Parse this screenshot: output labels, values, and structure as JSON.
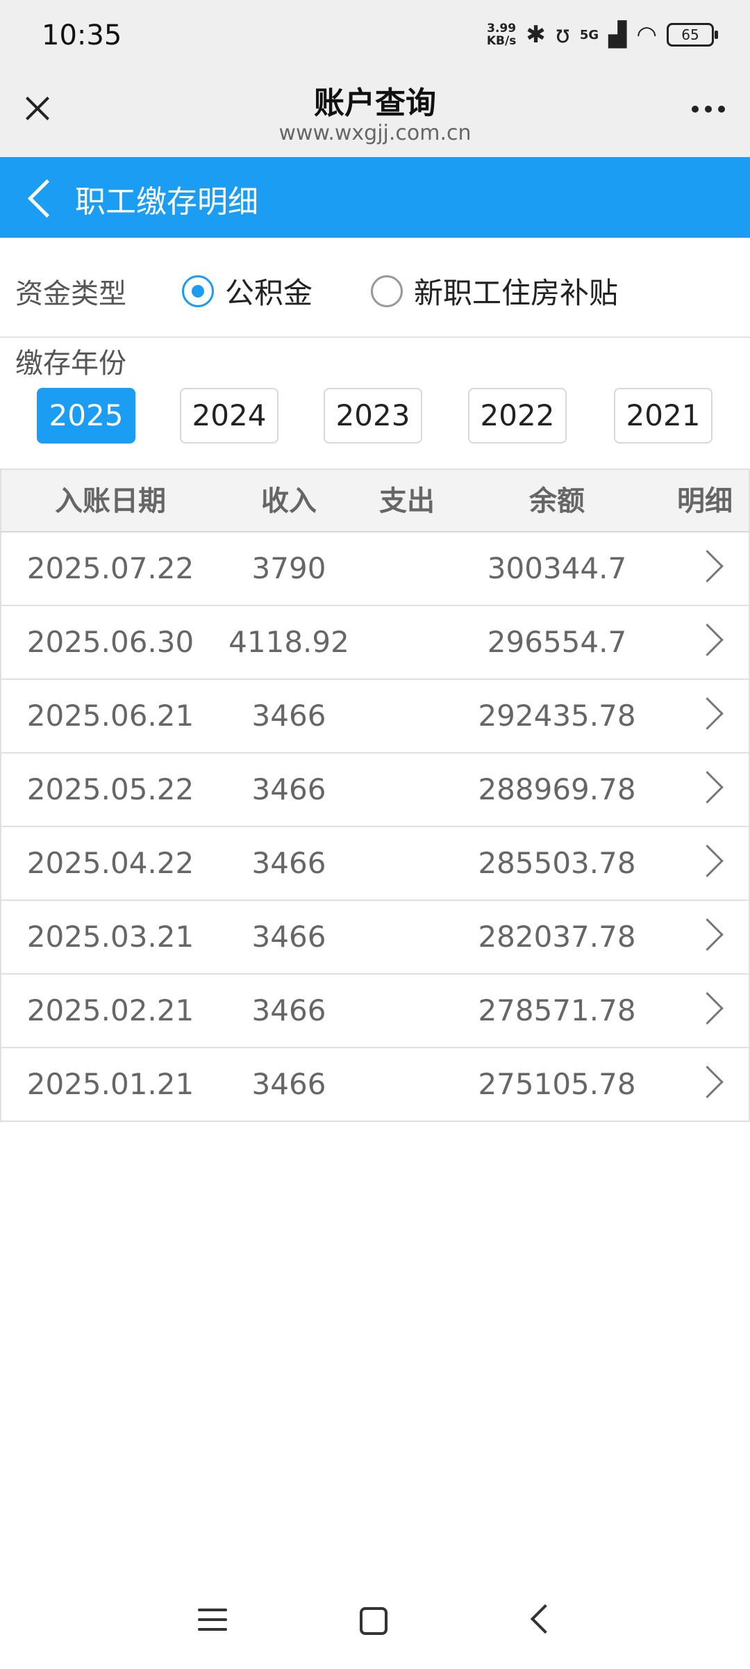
{
  "status_bar": {
    "time": "10:35",
    "net_speed_value": "3.99",
    "net_speed_unit": "KB/s",
    "network": "5G",
    "battery": "65"
  },
  "browser": {
    "title": "账户查询",
    "url": "www.wxgjj.com.cn"
  },
  "page": {
    "title": "职工缴存明细"
  },
  "fund_type": {
    "label": "资金类型",
    "options": [
      {
        "label": "公积金",
        "checked": true
      },
      {
        "label": "新职工住房补贴",
        "checked": false
      }
    ]
  },
  "year": {
    "label": "缴存年份",
    "options": [
      "2025",
      "2024",
      "2023",
      "2022",
      "2021"
    ],
    "selected": "2025"
  },
  "table": {
    "headers": {
      "date": "入账日期",
      "income": "收入",
      "expense": "支出",
      "balance": "余额",
      "detail": "明细"
    },
    "rows": [
      {
        "date": "2025.07.22",
        "income": "3790",
        "expense": "",
        "balance": "300344.7"
      },
      {
        "date": "2025.06.30",
        "income": "4118.92",
        "expense": "",
        "balance": "296554.7"
      },
      {
        "date": "2025.06.21",
        "income": "3466",
        "expense": "",
        "balance": "292435.78"
      },
      {
        "date": "2025.05.22",
        "income": "3466",
        "expense": "",
        "balance": "288969.78"
      },
      {
        "date": "2025.04.22",
        "income": "3466",
        "expense": "",
        "balance": "285503.78"
      },
      {
        "date": "2025.03.21",
        "income": "3466",
        "expense": "",
        "balance": "282037.78"
      },
      {
        "date": "2025.02.21",
        "income": "3466",
        "expense": "",
        "balance": "278571.78"
      },
      {
        "date": "2025.01.21",
        "income": "3466",
        "expense": "",
        "balance": "275105.78"
      }
    ]
  },
  "colors": {
    "accent": "#1a9df2",
    "header_bg": "#1a9df2",
    "browser_bg": "#efefef"
  }
}
